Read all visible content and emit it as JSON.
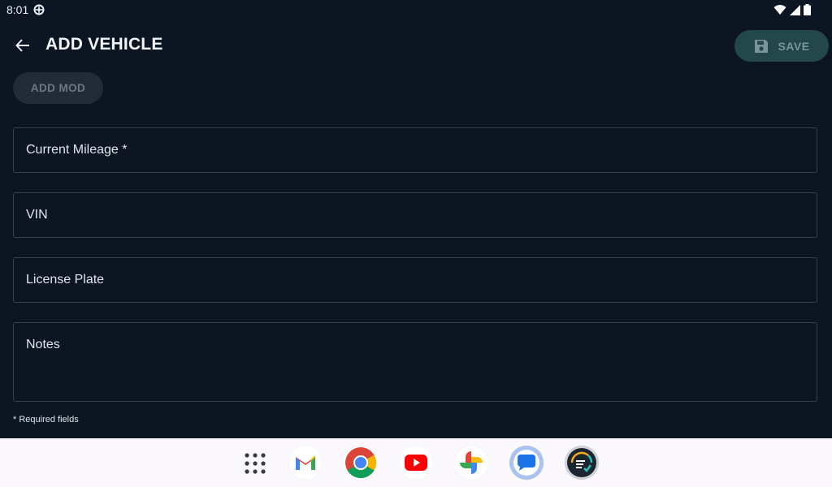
{
  "status": {
    "time": "8:01"
  },
  "appbar": {
    "title": "ADD VEHICLE",
    "save_label": "SAVE"
  },
  "actions": {
    "add_mod_label": "ADD MOD"
  },
  "fields": {
    "mileage": "Current Mileage *",
    "vin": "VIN",
    "license_plate": "License Plate",
    "notes": "Notes"
  },
  "footer": {
    "required_note": "* Required fields"
  },
  "dock": {
    "apps": [
      "app-drawer",
      "gmail",
      "chrome",
      "youtube",
      "photos",
      "messages",
      "app"
    ]
  }
}
